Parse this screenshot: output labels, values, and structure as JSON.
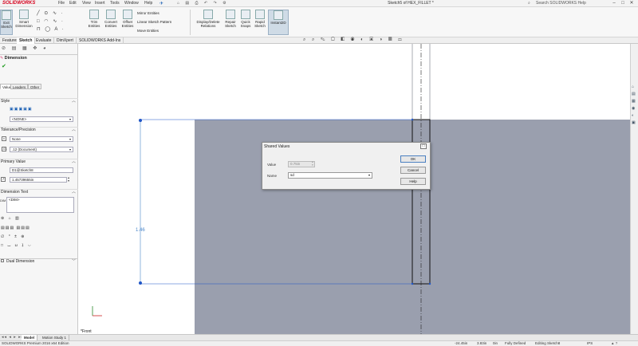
{
  "app": {
    "logo": "SOLIDWORKS",
    "title": "Sketch5 of HEX_FILLET *",
    "help_search_placeholder": "Search SOLIDWORKS Help"
  },
  "menu": [
    "File",
    "Edit",
    "View",
    "Insert",
    "Tools",
    "Window",
    "Help"
  ],
  "ribbon": {
    "exit_sketch": "Exit Sketch",
    "smart_dimension": "Smart Dimension",
    "trim_entities": "Trim Entities",
    "convert_entities": "Convert Entities",
    "offset_entities": "Offset Entities",
    "mirror_entities": "Mirror Entities",
    "linear_sketch_pattern": "Linear Sketch Pattern",
    "move_entities": "Move Entities",
    "display_delete_relations": "Display/Delete Relations",
    "repair_sketch": "Repair Sketch",
    "quick_snaps": "Quick Snaps",
    "rapid_sketch": "Rapid Sketch",
    "instant2d": "Instant2D"
  },
  "command_tabs": [
    "Features",
    "Sketch",
    "Evaluate",
    "DimXpert",
    "SOLIDWORKS Add-Ins"
  ],
  "property_manager": {
    "title": "Dimension",
    "tabs": [
      "Value",
      "Leaders",
      "Other"
    ],
    "style_label": "Style",
    "style_value": "<NONE>",
    "tolerance_label": "Tolerance/Precision",
    "tolerance_value": "None",
    "precision_value": ".12 (Document)",
    "primary_value_label": "Primary Value",
    "primary_name": "D1@Sketch8",
    "primary_value": "1.45739655in",
    "dimension_text_label": "Dimension Text",
    "dimension_text_value": "<DIM>",
    "dual_dimension_label": "Dual Dimension"
  },
  "canvas": {
    "dimension_label": "1.46",
    "view_label": "*Front"
  },
  "dialog": {
    "title": "Shared Values",
    "value_label": "Value",
    "value": "0.75in",
    "name_label": "Name",
    "name_value": "sd",
    "ok": "OK",
    "cancel": "Cancel",
    "help": "Help"
  },
  "bottom_tabs": [
    "Model",
    "Motion Study 1"
  ],
  "status": {
    "edition": "SOLIDWORKS Premium 2016 x64 Edition",
    "x": "-24.45in",
    "y": "3.83in",
    "z": "0in",
    "state": "Fully Defined",
    "editing": "Editing Sketch8",
    "units": "IPS"
  },
  "colors": {
    "part_face": "#9a9fae",
    "sketch_blue": "#1f55c7",
    "dim_blue": "#4a86c9"
  }
}
